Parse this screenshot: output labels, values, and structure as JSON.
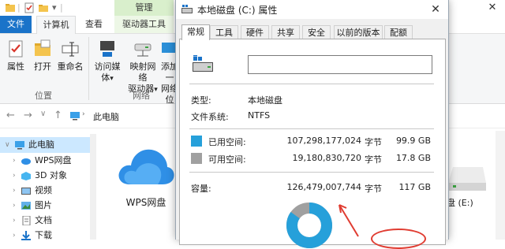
{
  "explorer": {
    "ribbon_tabs": {
      "file": "文件",
      "computer": "计算机",
      "view": "查看",
      "context_group": "管理",
      "drive_tools": "驱动器工具"
    },
    "ribbon_buttons": {
      "properties": "属性",
      "open": "打开",
      "rename": "重命名",
      "access_media_line1": "访问媒体",
      "map_drive_line1": "映射网络",
      "map_drive_line2": "驱动器",
      "add_network_line1": "添加一",
      "add_network_line2": "网络位"
    },
    "ribbon_groups": {
      "location": "位置",
      "network": "网络"
    },
    "address": {
      "path": "此电脑"
    },
    "sidebar": {
      "items": [
        {
          "label": "此电脑"
        },
        {
          "label": "WPS网盘"
        },
        {
          "label": "3D 对象"
        },
        {
          "label": "视频"
        },
        {
          "label": "图片"
        },
        {
          "label": "文档"
        },
        {
          "label": "下载"
        }
      ]
    },
    "content": {
      "wps_label": "WPS网盘",
      "drive_e_label": "盘 (E:)"
    }
  },
  "dialog": {
    "title": "本地磁盘 (C:) 属性",
    "tabs": [
      "常规",
      "工具",
      "硬件",
      "共享",
      "安全",
      "以前的版本",
      "配额"
    ],
    "label_value": "",
    "type_key": "类型:",
    "type_value": "本地磁盘",
    "fs_key": "文件系统:",
    "fs_value": "NTFS",
    "used_label": "已用空间:",
    "used_bytes": "107,298,177,024",
    "used_unit": "字节",
    "used_gb": "99.9 GB",
    "free_label": "可用空间:",
    "free_bytes": "19,180,830,720",
    "free_unit": "字节",
    "free_gb": "17.8 GB",
    "cap_label": "容量:",
    "cap_bytes": "126,479,007,744",
    "cap_unit": "字节",
    "cap_gb": "117 GB",
    "used_fraction": 0.848,
    "colors": {
      "used": "#26a0da",
      "free": "#a0a0a0"
    }
  }
}
